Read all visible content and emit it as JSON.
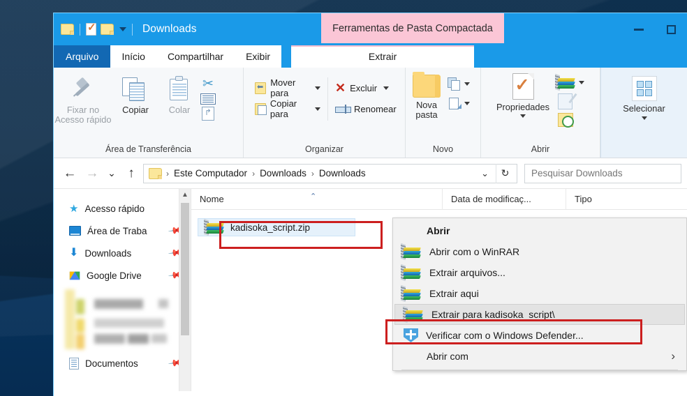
{
  "window": {
    "title": "Downloads",
    "contextual_tab_header": "Ferramentas de Pasta Compactada",
    "quick_access": [
      "folder-icon",
      "properties-icon",
      "new-folder-icon",
      "customize-caret-icon"
    ],
    "controls": {
      "minimize": "minimize-icon",
      "maximize": "maximize-icon"
    }
  },
  "tabs": [
    {
      "label": "Arquivo",
      "selected": true
    },
    {
      "label": "Início",
      "selected": false
    },
    {
      "label": "Compartilhar",
      "selected": false
    },
    {
      "label": "Exibir",
      "selected": false
    },
    {
      "label": "Extrair",
      "selected": false,
      "contextual": true
    }
  ],
  "ribbon": {
    "groups": [
      {
        "label": "Área de Transferência",
        "buttons": [
          {
            "label": "Fixar no\nAcesso rápido",
            "line1": "Fixar no",
            "line2": "Acesso rápido",
            "icon": "pin-icon",
            "enabled": true
          },
          {
            "label": "Copiar",
            "icon": "copy-icon",
            "enabled": true
          },
          {
            "label": "Colar",
            "icon": "paste-icon",
            "enabled": false
          }
        ],
        "small_icons": [
          "scissors-icon",
          "copy-path-icon",
          "paste-shortcut-icon"
        ]
      },
      {
        "label": "Organizar",
        "items": [
          {
            "label": "Mover para",
            "icon": "move-to-icon",
            "has_caret": true
          },
          {
            "label": "Copiar para",
            "icon": "copy-to-icon",
            "has_caret": true
          },
          {
            "label": "Excluir",
            "icon": "delete-icon",
            "has_caret": true
          },
          {
            "label": "Renomear",
            "icon": "rename-icon",
            "has_caret": false
          }
        ]
      },
      {
        "label": "Novo",
        "buttons": [
          {
            "line1": "Nova",
            "line2": "pasta",
            "icon": "new-folder-icon"
          }
        ],
        "small_icons": [
          "new-item-icon",
          "easy-access-icon"
        ]
      },
      {
        "label": "Abrir",
        "buttons": [
          {
            "label": "Propriedades",
            "icon": "properties-icon",
            "has_caret": true
          }
        ],
        "small_icons": [
          "open-with-winrar-icon",
          "edit-icon",
          "history-icon"
        ]
      },
      {
        "label": "",
        "buttons": [
          {
            "label": "Selecionar",
            "icon": "select-all-icon",
            "has_caret": true
          }
        ],
        "highlighted": true
      }
    ]
  },
  "addressbar": {
    "back": "back-arrow-icon",
    "forward": "forward-arrow-icon",
    "recent": "recent-locations-caret-icon",
    "up": "up-arrow-icon",
    "breadcrumbs": [
      "Este Computador",
      "Downloads",
      "Downloads"
    ],
    "dropdown_caret": "breadcrumb-caret-icon",
    "refresh": "refresh-icon",
    "search_placeholder": "Pesquisar Downloads"
  },
  "navpane": {
    "items": [
      {
        "label": "Acesso rápido",
        "icon": "star-icon",
        "pinned": false
      },
      {
        "label": "Área de Traba",
        "icon": "desktop-icon",
        "pinned": true
      },
      {
        "label": "Downloads",
        "icon": "download-arrow-icon",
        "pinned": true
      },
      {
        "label": "Google Drive",
        "icon": "google-drive-icon",
        "pinned": true
      },
      {
        "label": "",
        "icon": "blurred-icon",
        "blurred": true
      },
      {
        "label": "Documentos",
        "icon": "document-icon",
        "pinned": true
      }
    ],
    "scrollbar": {
      "up": "scroll-up-icon",
      "down": "scroll-down-icon"
    }
  },
  "filelist": {
    "columns": [
      {
        "label": "Nome",
        "sorted": true,
        "sort_direction": "asc"
      },
      {
        "label": "Data de modificaç...",
        "sorted": false
      },
      {
        "label": "Tipo",
        "sorted": false
      }
    ],
    "rows": [
      {
        "name": "kadisoka_script.zip",
        "icon": "zip-archive-icon",
        "selected": true
      }
    ]
  },
  "context_menu": {
    "items": [
      {
        "label": "Abrir",
        "icon": null,
        "bold": true,
        "highlighted": false
      },
      {
        "label": "Abrir com o WinRAR",
        "icon": "winrar-icon",
        "bold": false,
        "highlighted": false
      },
      {
        "label": "Extrair arquivos...",
        "icon": "winrar-icon",
        "bold": false,
        "highlighted": false
      },
      {
        "label": "Extrair aqui",
        "icon": "winrar-icon",
        "bold": false,
        "highlighted": false
      },
      {
        "label": "Extrair para kadisoka_script\\",
        "icon": "winrar-icon",
        "bold": false,
        "highlighted": true
      },
      {
        "label": "Verificar com o Windows Defender...",
        "icon": "windows-defender-icon",
        "bold": false,
        "highlighted": false
      },
      {
        "label": "Abrir com",
        "icon": null,
        "bold": false,
        "highlighted": false,
        "submenu": true
      }
    ]
  },
  "annotations": {
    "highlight_color": "#cc1f1f",
    "boxes": [
      {
        "name": "selected-file-highlight",
        "target": "kadisoka_script.zip"
      },
      {
        "name": "extract-to-folder-highlight",
        "target": "Extrair para kadisoka_script\\"
      }
    ]
  },
  "colors": {
    "titlebar": "#1a9ae8",
    "file_tab": "#1268b3",
    "contextual_tab": "#fbc6d6",
    "annotation_red": "#cc1f1f",
    "desktop": "#0a3d6b"
  }
}
